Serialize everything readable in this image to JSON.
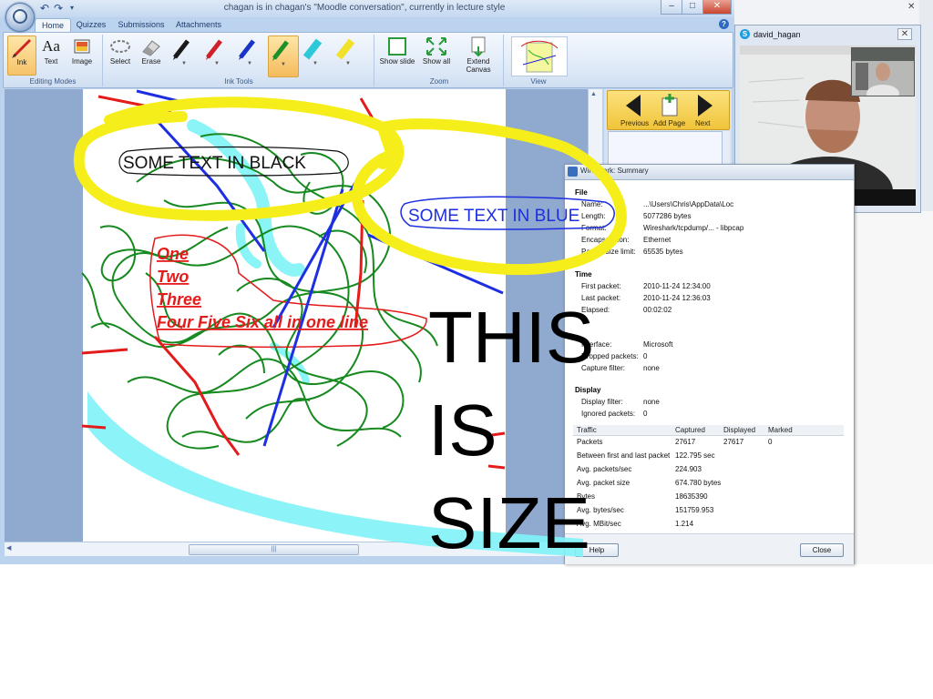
{
  "window": {
    "title": "chagan is in chagan's \"Moodle conversation\", currently in lecture style"
  },
  "tabs": [
    {
      "label": "Home"
    },
    {
      "label": "Quizzes"
    },
    {
      "label": "Submissions"
    },
    {
      "label": "Attachments"
    }
  ],
  "ribbon": {
    "groups": {
      "editing": "Editing Modes",
      "ink_tools": "Ink Tools",
      "zoom": "Zoom",
      "view": "View"
    },
    "buttons": {
      "ink": "Ink",
      "text": "Text",
      "image": "Image",
      "select": "Select",
      "erase": "Erase",
      "show_slide": "Show slide",
      "show_all": "Show all",
      "extend_canvas": "Extend Canvas"
    },
    "text_icon_glyph": "Aa",
    "pen_colors": [
      "#1a1a1a",
      "#d0202a",
      "#1a33c8",
      "#1f8f2a",
      "#2ec9d8",
      "#f2e12a"
    ]
  },
  "nav": {
    "previous": "Previous",
    "add_page": "Add Page",
    "next": "Next"
  },
  "skype": {
    "name": "david_hagan"
  },
  "slide_content": {
    "black_text": "SOME TEXT IN BLACK",
    "blue_text": "SOME TEXT IN BLUE",
    "red_lines": [
      "One",
      "Two",
      "Three",
      "Four Five Six all in one line"
    ],
    "big_text": [
      "THIS",
      "IS",
      "SIZE"
    ]
  },
  "wireshark": {
    "title": "Wireshark: Summary",
    "file": {
      "heading": "File",
      "rows": [
        {
          "k": "Name:",
          "v": "...\\Users\\Chris\\AppData\\Loc"
        },
        {
          "k": "Length:",
          "v": "5077286 bytes"
        },
        {
          "k": "Format:",
          "v": "Wireshark/tcpdump/... - libpcap"
        },
        {
          "k": "Encapsulation:",
          "v": "Ethernet"
        },
        {
          "k": "Packet size limit:",
          "v": "65535 bytes"
        }
      ]
    },
    "time": {
      "heading": "Time",
      "rows": [
        {
          "k": "First packet:",
          "v": "2010-11-24 12:34:00"
        },
        {
          "k": "Last packet:",
          "v": "2010-11-24 12:36:03"
        },
        {
          "k": "Elapsed:",
          "v": "00:02:02"
        }
      ]
    },
    "capture": {
      "rows": [
        {
          "k": "Interface:",
          "v": "Microsoft"
        },
        {
          "k": "Dropped packets:",
          "v": "0"
        },
        {
          "k": "Capture filter:",
          "v": "none"
        }
      ]
    },
    "display": {
      "heading": "Display",
      "rows": [
        {
          "k": "Display filter:",
          "v": "none"
        },
        {
          "k": "Ignored packets:",
          "v": "0"
        }
      ]
    },
    "traffic": {
      "headers": [
        "Traffic",
        "Captured",
        "Displayed",
        "Marked"
      ],
      "rows": [
        {
          "k": "Packets",
          "c": "27617",
          "d": "27617",
          "m": "0"
        },
        {
          "k": "Between first and last packet",
          "c": "122.795 sec",
          "d": "",
          "m": ""
        },
        {
          "k": "Avg. packets/sec",
          "c": "224.903",
          "d": "",
          "m": ""
        },
        {
          "k": "Avg. packet size",
          "c": "674.780 bytes",
          "d": "",
          "m": ""
        },
        {
          "k": "Bytes",
          "c": "18635390",
          "d": "",
          "m": ""
        },
        {
          "k": "Avg. bytes/sec",
          "c": "151759.953",
          "d": "",
          "m": ""
        },
        {
          "k": "Avg. MBit/sec",
          "c": "1.214",
          "d": "",
          "m": ""
        }
      ]
    },
    "help_label": "Help",
    "close_label": "Close"
  },
  "colors": {
    "ink_red": "#e41b1b",
    "ink_blue": "#1d2fe0",
    "ink_green": "#16891f",
    "ink_cyan": "#7ff3f7",
    "highlight_yellow": "#f5ee1a"
  }
}
